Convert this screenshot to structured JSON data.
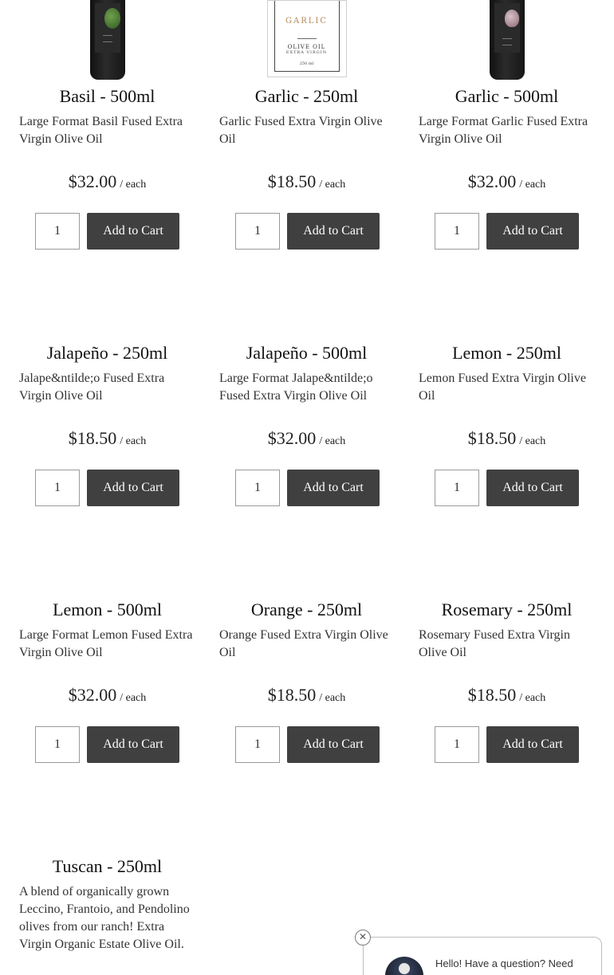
{
  "products": [
    {
      "id": "basil-500",
      "title": "Basil - 500ml",
      "description": "Large Format Basil Fused Extra Virgin Olive Oil",
      "price": "$32.00",
      "per": "/ each",
      "qty": "1",
      "button": "Add to Cart",
      "image": "basil-bottle"
    },
    {
      "id": "garlic-250",
      "title": "Garlic - 250ml",
      "description": "Garlic Fused Extra Virgin Olive Oil",
      "price": "$18.50",
      "per": "/ each",
      "qty": "1",
      "button": "Add to Cart",
      "image": "garlic-box",
      "box_label": {
        "name": "GARLIC",
        "line1": "OLIVE OIL",
        "line2": "EXTRA VIRGIN",
        "volume": "250 ml"
      }
    },
    {
      "id": "garlic-500",
      "title": "Garlic - 500ml",
      "description": "Large Format Garlic Fused Extra Virgin Olive Oil",
      "price": "$32.00",
      "per": "/ each",
      "qty": "1",
      "button": "Add to Cart",
      "image": "garlic-bottle"
    },
    {
      "id": "jalapeno-250",
      "title": "Jalapeño - 250ml",
      "description": "Jalape&ntilde;o Fused Extra Virgin Olive Oil",
      "price": "$18.50",
      "per": "/ each",
      "qty": "1",
      "button": "Add to Cart"
    },
    {
      "id": "jalapeno-500",
      "title": "Jalapeño - 500ml",
      "description": "Large Format Jalape&ntilde;o Fused Extra Virgin Olive Oil",
      "price": "$32.00",
      "per": "/ each",
      "qty": "1",
      "button": "Add to Cart"
    },
    {
      "id": "lemon-250",
      "title": "Lemon - 250ml",
      "description": "Lemon Fused Extra Virgin Olive Oil",
      "price": "$18.50",
      "per": "/ each",
      "qty": "1",
      "button": "Add to Cart"
    },
    {
      "id": "lemon-500",
      "title": "Lemon - 500ml",
      "description": "Large Format Lemon Fused Extra Virgin Olive Oil",
      "price": "$32.00",
      "per": "/ each",
      "qty": "1",
      "button": "Add to Cart"
    },
    {
      "id": "orange-250",
      "title": "Orange - 250ml",
      "description": "Orange Fused Extra Virgin Olive Oil",
      "price": "$18.50",
      "per": "/ each",
      "qty": "1",
      "button": "Add to Cart"
    },
    {
      "id": "rosemary-250",
      "title": "Rosemary - 250ml",
      "description": "Rosemary Fused Extra Virgin Olive Oil",
      "price": "$18.50",
      "per": "/ each",
      "qty": "1",
      "button": "Add to Cart"
    },
    {
      "id": "tuscan-250",
      "title": "Tuscan - 250ml",
      "description": "A blend of organically grown Leccino, Frantoio, and Pendolino olives from our ranch! Extra Virgin Organic Estate Olive Oil."
    }
  ],
  "chat": {
    "message": "Hello! Have a question? Need",
    "close_icon": "close-circle-icon"
  },
  "colors": {
    "button_bg": "#404040",
    "button_text": "#ffffff"
  }
}
